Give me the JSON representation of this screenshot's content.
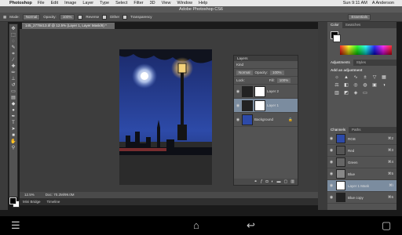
{
  "menubar": {
    "apple": "",
    "app_name": "Photoshop",
    "items": [
      "File",
      "Edit",
      "Image",
      "Layer",
      "Type",
      "Select",
      "Filter",
      "3D",
      "View",
      "Window",
      "Help"
    ],
    "clock": "Sun 9:11 AM",
    "user": "A Anderson"
  },
  "window_title": "Adobe Photoshop CS6",
  "options": {
    "mode_label": "Mode:",
    "mode_value": "Normal",
    "opacity_label": "Opacity:",
    "opacity_value": "100%",
    "reverse": "Reverse",
    "dither": "Dither",
    "transparency": "Transparency",
    "workspace": "Essentials"
  },
  "document": {
    "tab": "145_2778413.tif @ 12.5% (Layer 1, Layer Mask/8) *",
    "zoom": "12.5%",
    "doc_size": "Doc: 70.2M/99.0M"
  },
  "minibridge": {
    "tab1": "Mini Bridge",
    "tab2": "Timeline"
  },
  "layers_panel": {
    "title": "Layers",
    "kind": "Kind",
    "blend": "Normal",
    "opacity_label": "Opacity:",
    "opacity_value": "100%",
    "lock_label": "Lock:",
    "fill_label": "Fill:",
    "fill_value": "100%",
    "layers": [
      {
        "name": "Layer 2"
      },
      {
        "name": "Layer 1"
      },
      {
        "name": "Background"
      }
    ]
  },
  "color_panel": {
    "tab1": "Color",
    "tab2": "Swatches"
  },
  "adjust_panel": {
    "tab1": "Adjustments",
    "tab2": "Styles",
    "title": "Add an adjustment"
  },
  "channels_panel": {
    "tab1": "Channels",
    "tab2": "Paths",
    "rows": [
      {
        "name": "RGB",
        "shortcut": "⌘2"
      },
      {
        "name": "Red",
        "shortcut": "⌘3"
      },
      {
        "name": "Green",
        "shortcut": "⌘4"
      },
      {
        "name": "Blue",
        "shortcut": "⌘5"
      },
      {
        "name": "Layer 1 Mask",
        "shortcut": "⌘\\"
      },
      {
        "name": "Blue copy",
        "shortcut": "⌘6"
      }
    ]
  },
  "navbar": {
    "menu": "☰",
    "home": "⌂",
    "back": "↩",
    "apps": "▢"
  }
}
